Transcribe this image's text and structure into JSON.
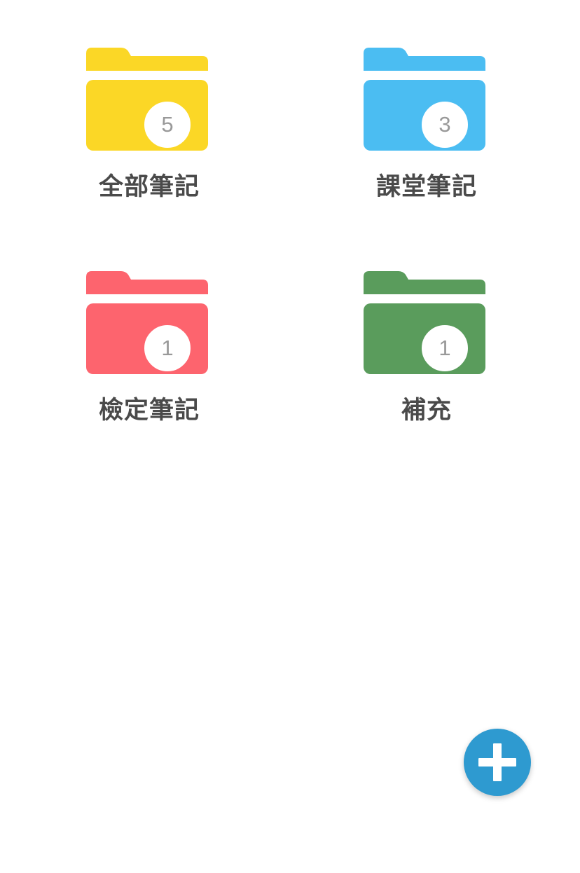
{
  "folders": [
    {
      "label": "全部筆記",
      "count": "5",
      "color": "#fbd726",
      "icon": "folder-icon"
    },
    {
      "label": "課堂筆記",
      "count": "3",
      "color": "#4bbdf2",
      "icon": "folder-icon"
    },
    {
      "label": "檢定筆記",
      "count": "1",
      "color": "#fd646e",
      "icon": "folder-icon"
    },
    {
      "label": "補充",
      "count": "1",
      "color": "#5a9c5c",
      "icon": "folder-icon"
    }
  ],
  "fab": {
    "icon": "plus-icon",
    "color": "#2e9ad0"
  }
}
